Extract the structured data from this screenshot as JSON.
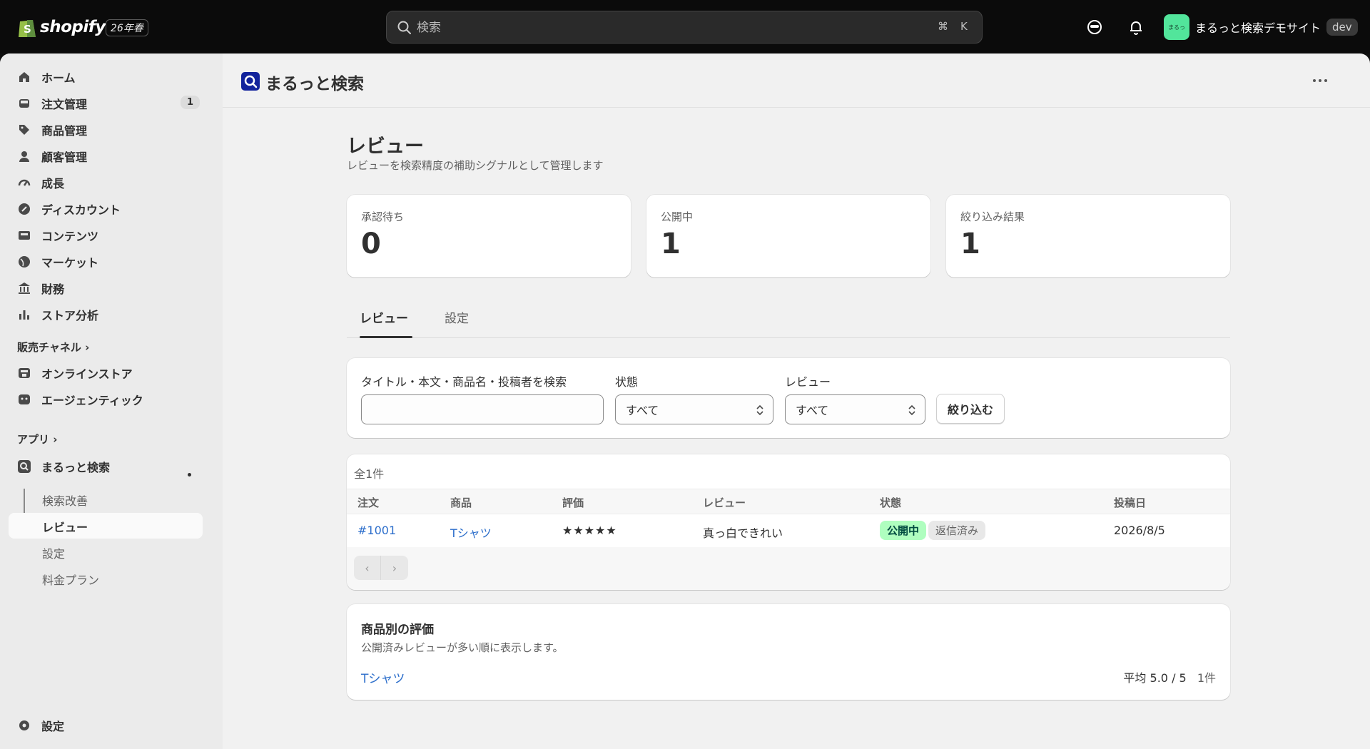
{
  "topbar": {
    "logo_text": "shopify",
    "edition": "26年春",
    "search_placeholder": "検索",
    "shortcut_cmd": "⌘",
    "shortcut_key": "K",
    "store_avatar": "まるっ",
    "store_name": "まるっと検索デモサイト",
    "store_tag": "dev"
  },
  "sidebar": {
    "items": [
      {
        "label": "ホーム",
        "icon": "home-icon"
      },
      {
        "label": "注文管理",
        "icon": "inbox-icon",
        "badge": "1"
      },
      {
        "label": "商品管理",
        "icon": "tag-icon"
      },
      {
        "label": "顧客管理",
        "icon": "person-icon"
      },
      {
        "label": "成長",
        "icon": "gauge-icon"
      },
      {
        "label": "ディスカウント",
        "icon": "discount-icon"
      },
      {
        "label": "コンテンツ",
        "icon": "content-icon"
      },
      {
        "label": "マーケット",
        "icon": "globe-icon"
      },
      {
        "label": "財務",
        "icon": "bank-icon"
      },
      {
        "label": "ストア分析",
        "icon": "chart-icon"
      }
    ],
    "sales_channels_heading": "販売チャネル",
    "channels": [
      {
        "label": "オンラインストア",
        "icon": "store-icon"
      },
      {
        "label": "エージェンティック",
        "icon": "agent-icon"
      }
    ],
    "apps_heading": "アプリ",
    "app": {
      "label": "まるっと検索",
      "icon": "app-search-icon"
    },
    "app_sub": [
      "検索改善",
      "レビュー",
      "設定",
      "料金プラン"
    ],
    "settings": "設定"
  },
  "app_header": {
    "title": "まるっと検索"
  },
  "page": {
    "title": "レビュー",
    "subtitle": "レビューを検索精度の補助シグナルとして管理します"
  },
  "stats": [
    {
      "label": "承認待ち",
      "value": "0"
    },
    {
      "label": "公開中",
      "value": "1"
    },
    {
      "label": "絞り込み結果",
      "value": "1"
    }
  ],
  "tabs": [
    "レビュー",
    "設定"
  ],
  "filters": {
    "search_label": "タイトル・本文・商品名・投稿者を検索",
    "search_value": "",
    "status_label": "状態",
    "status_value": "すべて",
    "review_label": "レビュー",
    "review_value": "すべて",
    "apply_button": "絞り込む"
  },
  "table": {
    "count": "全1件",
    "headers": [
      "注文",
      "商品",
      "評価",
      "レビュー",
      "状態",
      "投稿日"
    ],
    "rows": [
      {
        "order": "#1001",
        "product": "Tシャツ",
        "rating": "★★★★★",
        "review": "真っ白できれい",
        "status1": "公開中",
        "status2": "返信済み",
        "date": "2026/8/5"
      }
    ],
    "prev": "‹",
    "next": "›"
  },
  "product_ratings": {
    "title": "商品別の評価",
    "subtitle": "公開済みレビューが多い順に表示します。",
    "items": [
      {
        "product": "Tシャツ",
        "avg_label": "平均",
        "avg": "5.0 / 5",
        "count": "1件"
      }
    ]
  }
}
